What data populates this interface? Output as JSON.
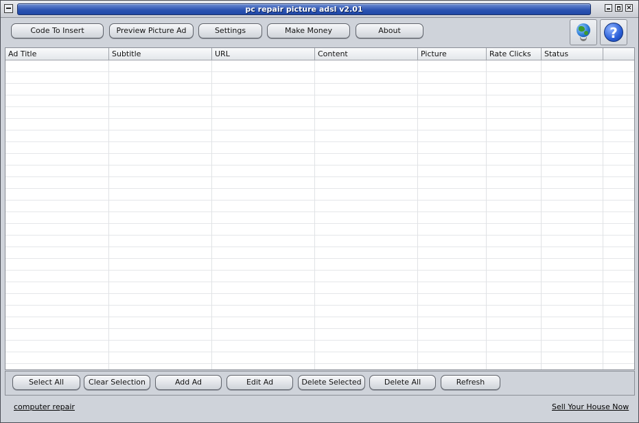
{
  "window": {
    "title": "pc repair picture adsl v2.01"
  },
  "toolbar": {
    "buttons": [
      "Code To Insert",
      "Preview Picture Ad",
      "Settings",
      "Make Money",
      "About"
    ],
    "icons": [
      "globe-icon",
      "help-icon"
    ]
  },
  "table": {
    "columns": [
      "Ad Title",
      "Subtitle",
      "URL",
      "Content",
      "Picture",
      "Rate Clicks",
      "Status"
    ],
    "rows": []
  },
  "actions": {
    "buttons": [
      "Select All",
      "Clear Selection",
      "Add Ad",
      "Edit Ad",
      "Delete Selected",
      "Delete All",
      "Refresh"
    ]
  },
  "footer": {
    "left_link": "computer repair",
    "right_link": "Sell Your House Now"
  }
}
